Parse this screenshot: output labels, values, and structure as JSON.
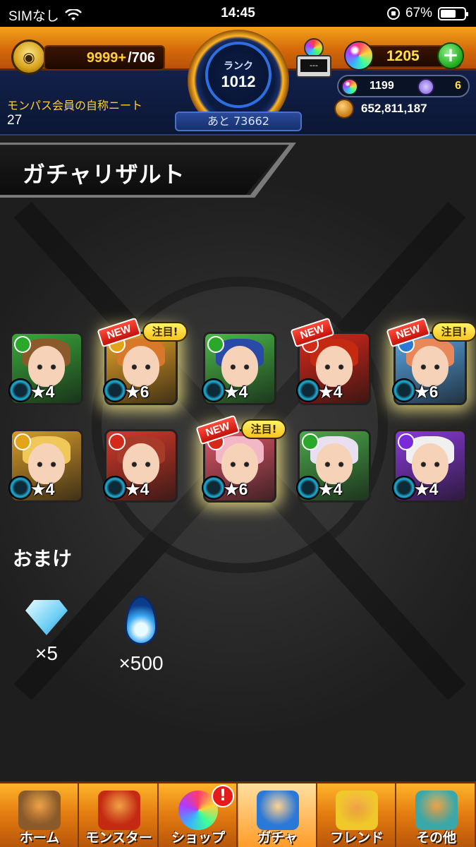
{
  "status_bar": {
    "carrier": "SIMなし",
    "time": "14:45",
    "battery_text": "67%",
    "battery_level": 0.67
  },
  "header": {
    "stamina_current": "9999+",
    "stamina_max": "/706",
    "rank_label": "ランク",
    "rank_value": "1012",
    "rank_next": "あと 73662",
    "gacha_machine_display": "---",
    "orb_count": "1205",
    "orb_plus_label": "+",
    "orb_small_count": "1199",
    "orb_secondary_count": "6",
    "coin_count": "652,811,187",
    "user_title": "モンパス会員の自称ニート",
    "user_sub": "27"
  },
  "page_title": "ガチャリザルト",
  "colors": {
    "fire": "#d42a1a",
    "wood": "#2aa82a",
    "water": "#2a78d8",
    "light": "#e2a51a",
    "dark": "#7a2ad8",
    "accent": "#ffcf34"
  },
  "results": [
    {
      "stars": "★4",
      "attribute": "wood",
      "hair": "#8a5a2a",
      "bg": "#3aa83a",
      "is_new": false,
      "featured": false
    },
    {
      "stars": "★6",
      "attribute": "light",
      "hair": "#d8782a",
      "bg": "#e8a428",
      "is_new": true,
      "featured": true
    },
    {
      "stars": "★4",
      "attribute": "wood",
      "hair": "#2a4aa8",
      "bg": "#4ab848",
      "is_new": false,
      "featured": false
    },
    {
      "stars": "★4",
      "attribute": "fire",
      "hair": "#c42a12",
      "bg": "#d8281a",
      "is_new": true,
      "featured": false
    },
    {
      "stars": "★6",
      "attribute": "water",
      "hair": "#e8885a",
      "bg": "#5aa8e8",
      "is_new": true,
      "featured": true
    },
    {
      "stars": "★4",
      "attribute": "light",
      "hair": "#f0c85a",
      "bg": "#d89a2a",
      "is_new": false,
      "featured": false
    },
    {
      "stars": "★4",
      "attribute": "fire",
      "hair": "#a83a2a",
      "bg": "#d43a2a",
      "is_new": false,
      "featured": false
    },
    {
      "stars": "★6",
      "attribute": "fire",
      "hair": "#f2b8c8",
      "bg": "#e2586a",
      "is_new": true,
      "featured": true
    },
    {
      "stars": "★4",
      "attribute": "wood",
      "hair": "#e8e0f0",
      "bg": "#4aa84a",
      "is_new": false,
      "featured": false
    },
    {
      "stars": "★4",
      "attribute": "dark",
      "hair": "#f0f0f0",
      "bg": "#8a3ad8",
      "is_new": false,
      "featured": false
    }
  ],
  "labels": {
    "new": "NEW",
    "featured": "注目!"
  },
  "bonus": {
    "title": "おまけ",
    "items": [
      {
        "icon": "diamond-icon",
        "qty": "×5"
      },
      {
        "icon": "soul-flame-icon",
        "qty": "×500"
      }
    ]
  },
  "nav": [
    {
      "label": "ホーム",
      "icon": "home-gate-icon",
      "color": "#8a5a2a"
    },
    {
      "label": "モンスター",
      "icon": "dragon-icon",
      "color": "#c42a12"
    },
    {
      "label": "ショップ",
      "icon": "orb-icon",
      "color": "#8a3ad8"
    },
    {
      "label": "ガチャ",
      "icon": "gacha-character-icon",
      "color": "#2a78d8"
    },
    {
      "label": "フレンド",
      "icon": "friends-icon",
      "color": "#f0c82a"
    },
    {
      "label": "その他",
      "icon": "other-icon",
      "color": "#3aa8a8"
    }
  ],
  "nav_alert": "!"
}
